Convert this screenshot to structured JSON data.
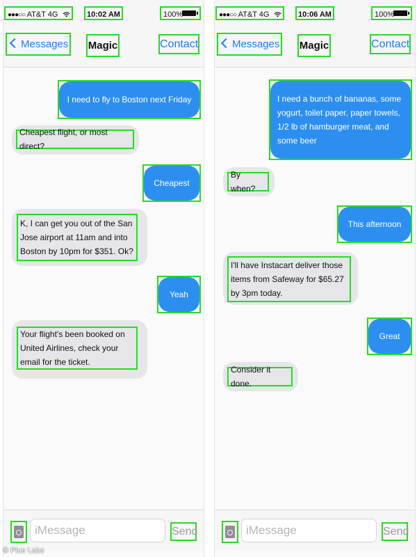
{
  "colors": {
    "outgoing_bubble": "#2c8ff0",
    "incoming_bubble": "#e6e6ea",
    "accent": "#1a7ef7",
    "highlight_box": "#22dd22"
  },
  "icons": [
    "signal-dots-icon",
    "wifi-icon",
    "battery-icon",
    "chevron-left-icon",
    "camera-icon"
  ],
  "screens": [
    {
      "status": {
        "signal": "●●●○○",
        "carrier": "AT&T 4G",
        "time": "10:02 AM",
        "battery": "100%"
      },
      "nav": {
        "back": "Messages",
        "title": "Magic",
        "contact": "Contact"
      },
      "messages": [
        {
          "from": "me",
          "text": "I need to fly to Boston next Friday"
        },
        {
          "from": "magic",
          "text": "Cheapest flight, or most direct?"
        },
        {
          "from": "me",
          "text": "Cheapest"
        },
        {
          "from": "magic",
          "text": "K, I can get you out of the San Jose airport at 11am and into Boston by 10pm for $351. Ok?"
        },
        {
          "from": "me",
          "text": "Yeah"
        },
        {
          "from": "magic",
          "text": "Your flight's been booked on United Airlines, check your email for the ticket."
        }
      ],
      "composer": {
        "placeholder": "iMessage",
        "send": "Send"
      }
    },
    {
      "status": {
        "signal": "●●●○○",
        "carrier": "AT&T 4G",
        "time": "10:06 AM",
        "battery": "100%"
      },
      "nav": {
        "back": "Messages",
        "title": "Magic",
        "contact": "Contact"
      },
      "messages": [
        {
          "from": "me",
          "text": "I need a bunch of bananas, some yogurt, toilet paper, paper towels, 1/2 lb of hamburger meat, and some beer"
        },
        {
          "from": "magic",
          "text": "By when?"
        },
        {
          "from": "me",
          "text": "This afternoon"
        },
        {
          "from": "magic",
          "text": "I'll have Instacart deliver those items from Safeway for $65.27 by 3pm today."
        },
        {
          "from": "me",
          "text": "Great"
        },
        {
          "from": "magic",
          "text": "Consider it done."
        }
      ],
      "composer": {
        "placeholder": "iMessage",
        "send": "Send"
      }
    }
  ],
  "watermark": "© Plus Labs"
}
